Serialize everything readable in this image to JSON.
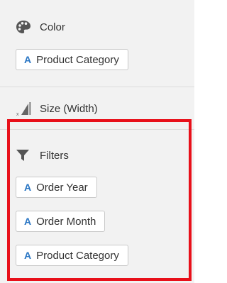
{
  "colors": {
    "panel_bg": "#f2f2f2",
    "pill_bg": "#ffffff",
    "pill_border": "#c9c9c9",
    "accent_blue": "#2a76c4",
    "highlight_red": "#e8101a",
    "icon_gray": "#555555"
  },
  "color_section": {
    "icon": "palette-icon",
    "label": "Color",
    "items": [
      {
        "type_icon": "A",
        "label": "Product Category"
      }
    ]
  },
  "size_section": {
    "icon": "size-width-icon",
    "label": "Size (Width)"
  },
  "filters_section": {
    "icon": "funnel-icon",
    "label": "Filters",
    "items": [
      {
        "type_icon": "A",
        "label": "Order Year"
      },
      {
        "type_icon": "A",
        "label": "Order Month"
      },
      {
        "type_icon": "A",
        "label": "Product Category"
      }
    ]
  }
}
